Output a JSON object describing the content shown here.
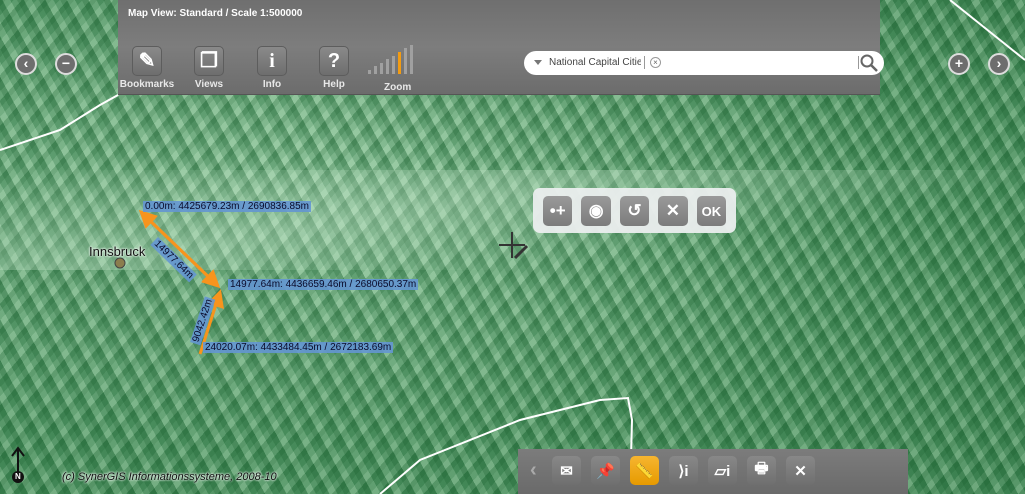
{
  "header": {
    "title": "Map View: Standard / Scale 1:500000"
  },
  "tools": [
    {
      "label": "Bookmarks",
      "icon": "bookmark-icon",
      "glyph": "✎"
    },
    {
      "label": "Views",
      "icon": "views-icon",
      "glyph": "❐"
    },
    {
      "label": "Info",
      "icon": "info-icon",
      "glyph": "i"
    },
    {
      "label": "Help",
      "icon": "help-icon",
      "glyph": "?"
    }
  ],
  "zoom": {
    "label": "Zoom",
    "level": 6,
    "levels": 8
  },
  "search": {
    "value": "National Capital Cities",
    "clear": "×"
  },
  "nav": {
    "back": "‹",
    "zoom_out": "−",
    "zoom_in": "+",
    "forward": "›"
  },
  "measure_toolbar": {
    "add_point": "•+",
    "center": "◉",
    "undo": "↺",
    "cancel": "✕",
    "ok": "OK"
  },
  "measurement": {
    "segments": [
      "14977.64m",
      "9042.42m"
    ],
    "points": [
      "0.00m: 4425679.23m / 2690836.85m",
      "14977.64m: 4436659.46m / 2680650.37m",
      "24020.07m: 4433484.45m / 2672183.69m"
    ]
  },
  "map": {
    "city": "Innsbruck",
    "copyright": "(c) SynerGIS Informationssysteme, 2008-10",
    "north": "N"
  },
  "bottom_toolbar": {
    "collapse": "‹",
    "email": "✉",
    "pin": "📌",
    "measure": "📏",
    "line_info": "⟩i",
    "area_info": "▱i",
    "print": "🖶",
    "close": "✕"
  },
  "colors": {
    "accent": "#f39c12",
    "label_bg": "#6496d2"
  }
}
